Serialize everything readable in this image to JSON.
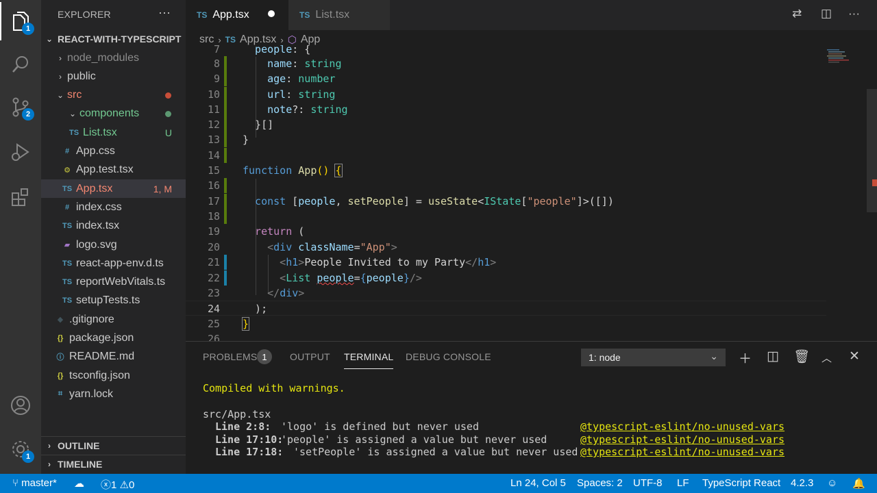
{
  "activity_bar": {
    "explorer_badge": "1",
    "scm_badge": "2",
    "settings_badge": "1"
  },
  "sidebar": {
    "title": "EXPLORER",
    "more": "···",
    "project": "REACT-WITH-TYPESCRIPT",
    "items": [
      {
        "label": "node_modules",
        "icon": "chevron-right",
        "color": "#8c8c8c"
      },
      {
        "label": "public",
        "icon": "chevron-right",
        "color": "#cccccc"
      },
      {
        "label": "src",
        "icon": "chevron-down",
        "color": "#f48771"
      },
      {
        "label": "components",
        "icon": "chevron-down",
        "color": "#73c991"
      },
      {
        "label": "List.tsx",
        "icon": "TS",
        "color": "#73c991",
        "status": "U"
      },
      {
        "label": "App.css",
        "icon": "#",
        "color": "#cccccc"
      },
      {
        "label": "App.test.tsx",
        "icon": "gear",
        "color": "#cccccc"
      },
      {
        "label": "App.tsx",
        "icon": "TS",
        "color": "#f48771",
        "status": "1, M"
      },
      {
        "label": "index.css",
        "icon": "#",
        "color": "#cccccc"
      },
      {
        "label": "index.tsx",
        "icon": "TS",
        "color": "#cccccc"
      },
      {
        "label": "logo.svg",
        "icon": "svg",
        "color": "#cccccc"
      },
      {
        "label": "react-app-env.d.ts",
        "icon": "TS",
        "color": "#cccccc"
      },
      {
        "label": "reportWebVitals.ts",
        "icon": "TS",
        "color": "#cccccc"
      },
      {
        "label": "setupTests.ts",
        "icon": "TS",
        "color": "#cccccc"
      },
      {
        "label": ".gitignore",
        "icon": "git",
        "color": "#cccccc"
      },
      {
        "label": "package.json",
        "icon": "{}",
        "color": "#cccccc"
      },
      {
        "label": "README.md",
        "icon": "info",
        "color": "#cccccc"
      },
      {
        "label": "tsconfig.json",
        "icon": "{}",
        "color": "#cccccc"
      },
      {
        "label": "yarn.lock",
        "icon": "yarn",
        "color": "#cccccc"
      }
    ],
    "outline": "OUTLINE",
    "timeline": "TIMELINE"
  },
  "tabs": [
    {
      "label": "App.tsx",
      "prefix": "TS",
      "active": true
    },
    {
      "label": "List.tsx",
      "prefix": "TS",
      "active": false
    }
  ],
  "breadcrumb": {
    "folder": "src",
    "prefix": "TS",
    "file": "App.tsx",
    "symbol": "App"
  },
  "editor": {
    "line_numbers": [
      "7",
      "8",
      "9",
      "10",
      "11",
      "12",
      "13",
      "14",
      "15",
      "16",
      "17",
      "18",
      "19",
      "20",
      "21",
      "22",
      "23",
      "24",
      "25",
      "26"
    ]
  },
  "panel": {
    "tabs": [
      "PROBLEMS",
      "OUTPUT",
      "TERMINAL",
      "DEBUG CONSOLE"
    ],
    "problems_count": "1",
    "terminal_select": "1: node",
    "terminal": {
      "compiled": "Compiled with warnings.",
      "file": "src/App.tsx",
      "warnings": [
        {
          "loc": "Line 2:8:",
          "msg": "'logo' is defined but never used",
          "rule": "@typescript-eslint/no-unused-vars"
        },
        {
          "loc": "Line 17:10:",
          "msg": "'people' is assigned a value but never used",
          "rule": "@typescript-eslint/no-unused-vars"
        },
        {
          "loc": "Line 17:18:",
          "msg": "'setPeople' is assigned a value but never used",
          "rule": "@typescript-eslint/no-unused-vars"
        }
      ]
    }
  },
  "statusbar": {
    "branch": "master*",
    "errors": "1",
    "warnings": "0",
    "position": "Ln 24, Col 5",
    "spaces": "Spaces: 2",
    "encoding": "UTF-8",
    "eol": "LF",
    "language": "TypeScript React",
    "version": "4.2.3"
  }
}
